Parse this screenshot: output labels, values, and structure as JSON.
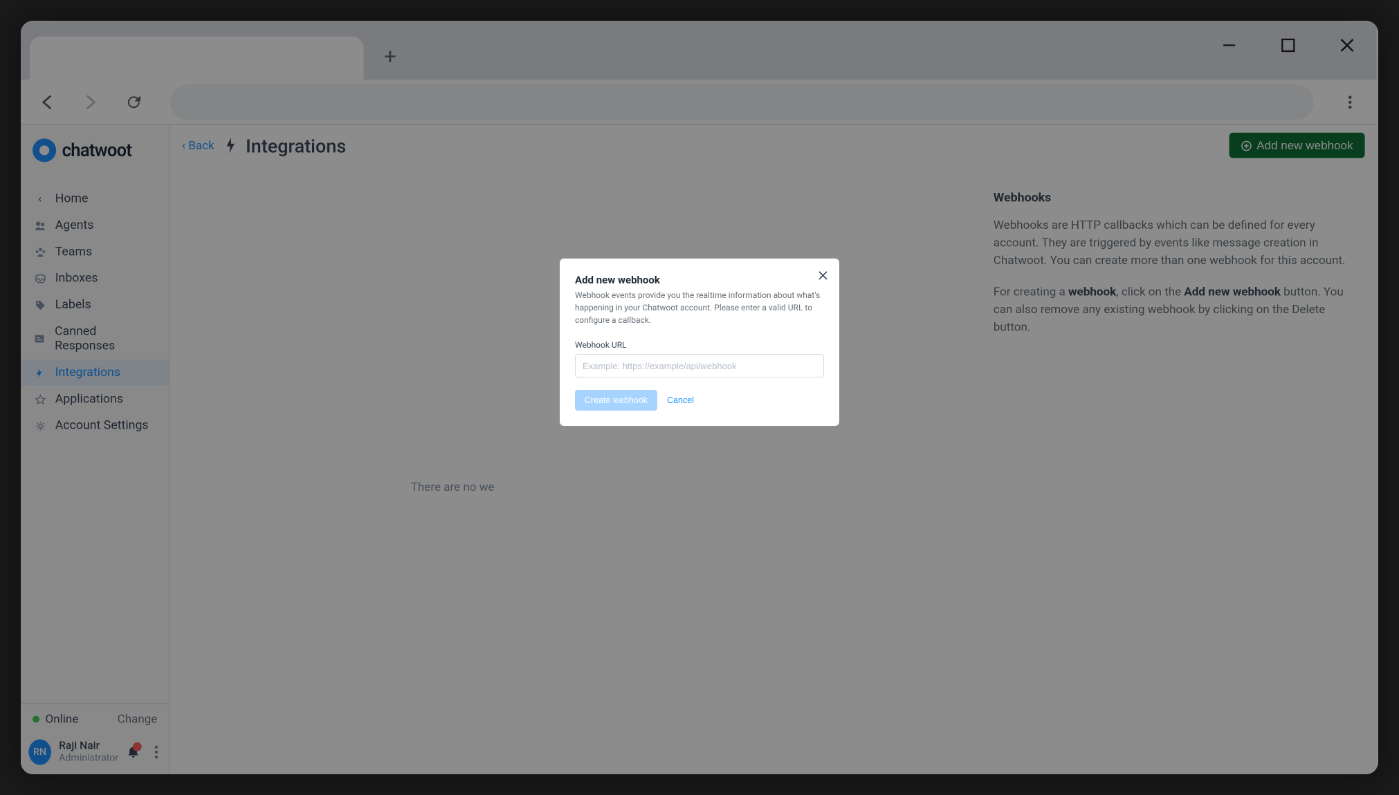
{
  "browser": {
    "new_tab_glyph": "+"
  },
  "logo": {
    "text": "chatwoot"
  },
  "sidebar": {
    "items": [
      {
        "label": "Home",
        "icon": "‹"
      },
      {
        "label": "Agents"
      },
      {
        "label": "Teams"
      },
      {
        "label": "Inboxes"
      },
      {
        "label": "Labels"
      },
      {
        "label": "Canned Responses"
      },
      {
        "label": "Integrations"
      },
      {
        "label": "Applications"
      },
      {
        "label": "Account Settings"
      }
    ]
  },
  "status": {
    "label": "Online",
    "change": "Change"
  },
  "user": {
    "initials": "RN",
    "name": "Raji Nair",
    "role": "Administrator"
  },
  "header": {
    "back": "Back",
    "title": "Integrations",
    "add_button": "Add new webhook"
  },
  "content": {
    "empty": "There are no we"
  },
  "info": {
    "heading": "Webhooks",
    "p1": "Webhooks are HTTP callbacks which can be defined for every account. They are triggered by events like message creation in Chatwoot. You can create more than one webhook for this account.",
    "p2_a": "For creating a ",
    "p2_b": "webhook",
    "p2_c": ", click on the ",
    "p2_d": "Add new webhook",
    "p2_e": " button. You can also remove any existing webhook by clicking on the Delete button."
  },
  "modal": {
    "title": "Add new webhook",
    "desc": "Webhook events provide you the realtime information about what's happening in your Chatwoot account. Please enter a valid URL to configure a callback.",
    "label": "Webhook URL",
    "placeholder": "Example: https://example/api/webhook",
    "create": "Create webhook",
    "cancel": "Cancel"
  }
}
